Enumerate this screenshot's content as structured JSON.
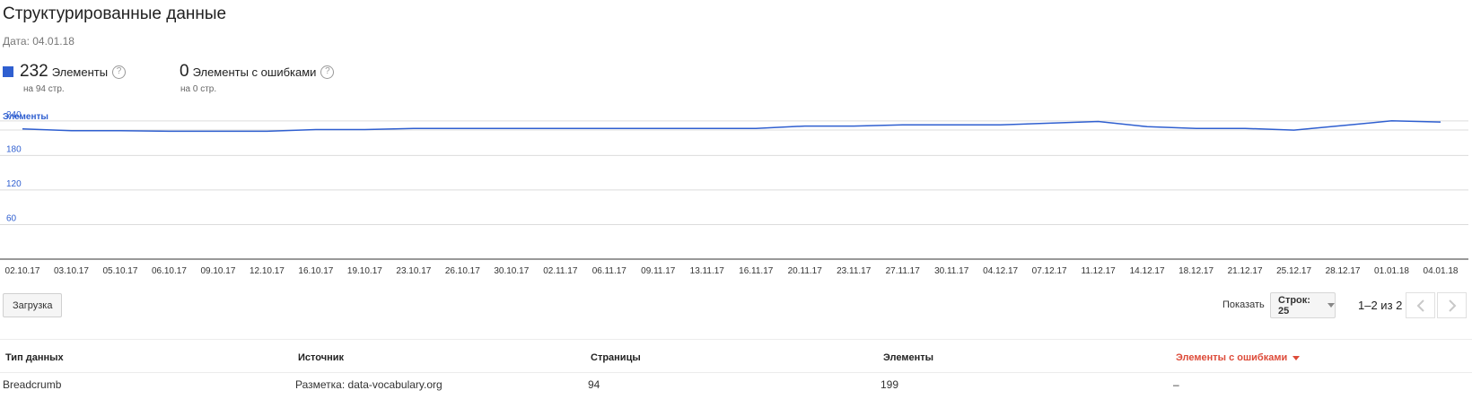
{
  "header": {
    "title": "Структурированные данные",
    "date": "Дата: 04.01.18"
  },
  "metrics": [
    {
      "value": "232",
      "label": "Элементы",
      "sub": "на 94 стр.",
      "color": "#2f5fd0"
    },
    {
      "value": "0",
      "label": "Элементы с ошибками",
      "sub": "на 0 стр."
    }
  ],
  "help_glyph": "?",
  "chart_data": {
    "type": "line",
    "series_label": "Элементы",
    "color": "#2f5fd0",
    "ylim": [
      0,
      260
    ],
    "yticks": [
      240,
      180,
      120,
      60
    ],
    "grid": true,
    "x": [
      "02.10.17",
      "03.10.17",
      "05.10.17",
      "06.10.17",
      "09.10.17",
      "12.10.17",
      "16.10.17",
      "19.10.17",
      "23.10.17",
      "26.10.17",
      "30.10.17",
      "02.11.17",
      "06.11.17",
      "09.11.17",
      "13.11.17",
      "16.11.17",
      "20.11.17",
      "23.11.17",
      "27.11.17",
      "30.11.17",
      "04.12.17",
      "07.12.17",
      "11.12.17",
      "14.12.17",
      "18.12.17",
      "21.12.17",
      "25.12.17",
      "28.12.17",
      "01.01.18",
      "04.01.18"
    ],
    "values": [
      226,
      223,
      223,
      222,
      222,
      222,
      225,
      225,
      227,
      227,
      227,
      227,
      227,
      227,
      227,
      227,
      231,
      231,
      233,
      233,
      233,
      236,
      239,
      230,
      227,
      227,
      224,
      232,
      240,
      238
    ]
  },
  "toolbar": {
    "upload_label": "Загрузка",
    "show_label": "Показать",
    "rows_label": "Строк: 25",
    "range": "1–2 из 2"
  },
  "table": {
    "columns": [
      "Тип данных",
      "Источник",
      "Страницы",
      "Элементы",
      "Элементы с ошибками"
    ],
    "rows": [
      [
        "Breadcrumb",
        "Разметка: data-vocabulary.org",
        "94",
        "199",
        "–"
      ]
    ]
  }
}
